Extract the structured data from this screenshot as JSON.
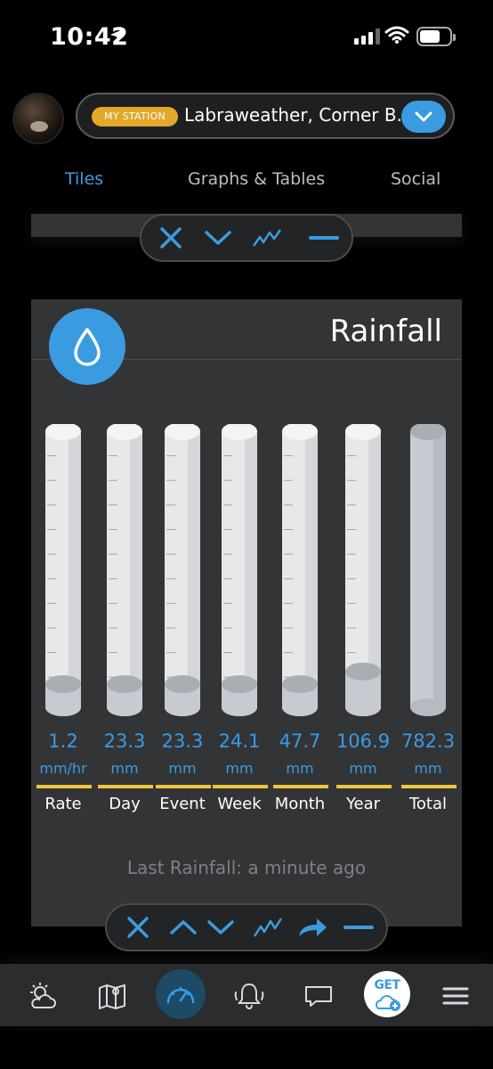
{
  "status": {
    "time": "10:42"
  },
  "header": {
    "badge": "MY STATION",
    "station_name": "Labraweather, Corner B."
  },
  "tabs": [
    {
      "label": "Tiles",
      "active": true
    },
    {
      "label": "Graphs & Tables",
      "active": false
    },
    {
      "label": "Social",
      "active": false
    }
  ],
  "tile": {
    "title": "Rainfall",
    "icon": "raindrop-icon",
    "columns": [
      {
        "value": "1.2",
        "unit": "mm/hr",
        "label": "Rate",
        "fill": 0.0
      },
      {
        "value": "23.3",
        "unit": "mm",
        "label": "Day",
        "fill": 0.0
      },
      {
        "value": "23.3",
        "unit": "mm",
        "label": "Event",
        "fill": 0.0
      },
      {
        "value": "24.1",
        "unit": "mm",
        "label": "Week",
        "fill": 0.0
      },
      {
        "value": "47.7",
        "unit": "mm",
        "label": "Month",
        "fill": 0.0
      },
      {
        "value": "106.9",
        "unit": "mm",
        "label": "Year",
        "fill": 0.05
      },
      {
        "value": "782.3",
        "unit": "mm",
        "label": "Total",
        "fill": 1.0
      }
    ],
    "last_rainfall": "Last Rainfall: a minute ago"
  },
  "bottom_nav": {
    "items": [
      "weather-icon",
      "map-icon",
      "dashboard-icon",
      "alerts-icon",
      "chat-icon",
      "get-cloud-icon",
      "menu-icon"
    ],
    "get_label": "GET"
  },
  "colors": {
    "accent": "#3b9be0",
    "badge": "#e3a82a",
    "underline": "#f0c53a",
    "tile_bg": "#333436"
  }
}
